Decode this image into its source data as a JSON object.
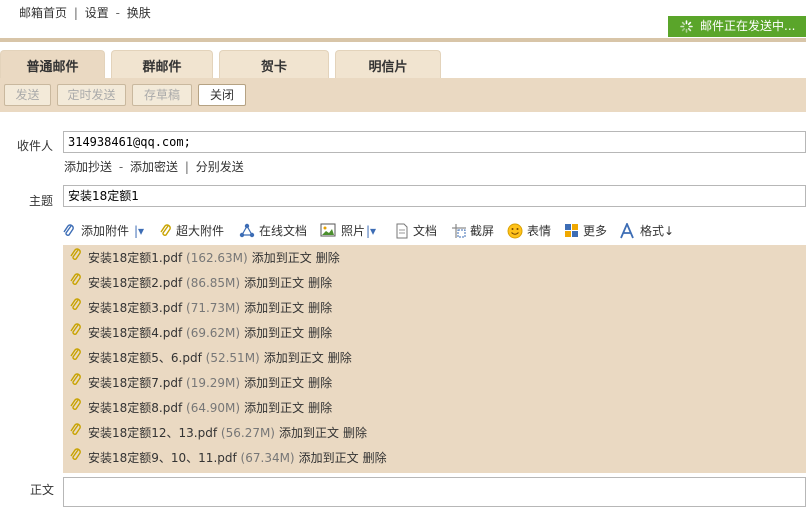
{
  "top": {
    "links": [
      "邮箱首页",
      "设置",
      "换肤"
    ],
    "sep1": "|",
    "sep2": "-",
    "status": "邮件正在发送中..."
  },
  "tabs": [
    "普通邮件",
    "群邮件",
    "贺卡",
    "明信片"
  ],
  "toolbar": {
    "send": "发送",
    "scheduled": "定时发送",
    "draft": "存草稿",
    "close": "关闭"
  },
  "form": {
    "to_label": "收件人",
    "to_value": "314938461@qq.com;",
    "add_cc": "添加抄送",
    "dash": "-",
    "add_bcc": "添加密送",
    "pipe": "|",
    "separate_send": "分别发送",
    "subject_label": "主题",
    "subject_value": "安装18定额1",
    "body_label": "正文"
  },
  "attach_toolbar": {
    "add_attachment": "添加附件",
    "large_attachment": "超大附件",
    "online_doc": "在线文档",
    "photo": "照片",
    "document": "文档",
    "screenshot": "截屏",
    "emoji": "表情",
    "more": "更多",
    "format": "格式↓"
  },
  "attachments": [
    {
      "name": "安装18定额1.pdf",
      "size": "(162.63M)",
      "add": "添加到正文",
      "del": "删除"
    },
    {
      "name": "安装18定额2.pdf",
      "size": "(86.85M)",
      "add": "添加到正文",
      "del": "删除"
    },
    {
      "name": "安装18定额3.pdf",
      "size": "(71.73M)",
      "add": "添加到正文",
      "del": "删除"
    },
    {
      "name": "安装18定额4.pdf",
      "size": "(69.62M)",
      "add": "添加到正文",
      "del": "删除"
    },
    {
      "name": "安装18定额5、6.pdf",
      "size": "(52.51M)",
      "add": "添加到正文",
      "del": "删除"
    },
    {
      "name": "安装18定额7.pdf",
      "size": "(19.29M)",
      "add": "添加到正文",
      "del": "删除"
    },
    {
      "name": "安装18定额8.pdf",
      "size": "(64.90M)",
      "add": "添加到正文",
      "del": "删除"
    },
    {
      "name": "安装18定额12、13.pdf",
      "size": "(56.27M)",
      "add": "添加到正文",
      "del": "删除"
    },
    {
      "name": "安装18定额9、10、11.pdf",
      "size": "(67.34M)",
      "add": "添加到正文",
      "del": "删除"
    }
  ],
  "colors": {
    "status_green": "#5aa52a",
    "tab_beige": "#f1e4d0",
    "panel_beige": "#ead9c2",
    "icon_blue": "#3d6db5"
  }
}
